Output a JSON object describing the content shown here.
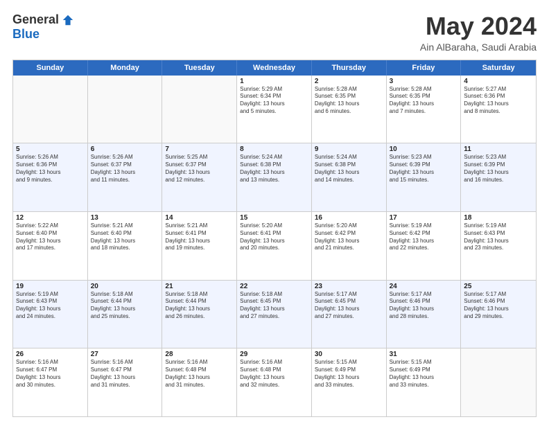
{
  "logo": {
    "general": "General",
    "blue": "Blue"
  },
  "title": "May 2024",
  "location": "Ain AlBaraha, Saudi Arabia",
  "days": [
    "Sunday",
    "Monday",
    "Tuesday",
    "Wednesday",
    "Thursday",
    "Friday",
    "Saturday"
  ],
  "weeks": [
    [
      {
        "day": "",
        "info": ""
      },
      {
        "day": "",
        "info": ""
      },
      {
        "day": "",
        "info": ""
      },
      {
        "day": "1",
        "info": "Sunrise: 5:29 AM\nSunset: 6:34 PM\nDaylight: 13 hours\nand 5 minutes."
      },
      {
        "day": "2",
        "info": "Sunrise: 5:28 AM\nSunset: 6:35 PM\nDaylight: 13 hours\nand 6 minutes."
      },
      {
        "day": "3",
        "info": "Sunrise: 5:28 AM\nSunset: 6:35 PM\nDaylight: 13 hours\nand 7 minutes."
      },
      {
        "day": "4",
        "info": "Sunrise: 5:27 AM\nSunset: 6:36 PM\nDaylight: 13 hours\nand 8 minutes."
      }
    ],
    [
      {
        "day": "5",
        "info": "Sunrise: 5:26 AM\nSunset: 6:36 PM\nDaylight: 13 hours\nand 9 minutes."
      },
      {
        "day": "6",
        "info": "Sunrise: 5:26 AM\nSunset: 6:37 PM\nDaylight: 13 hours\nand 11 minutes."
      },
      {
        "day": "7",
        "info": "Sunrise: 5:25 AM\nSunset: 6:37 PM\nDaylight: 13 hours\nand 12 minutes."
      },
      {
        "day": "8",
        "info": "Sunrise: 5:24 AM\nSunset: 6:38 PM\nDaylight: 13 hours\nand 13 minutes."
      },
      {
        "day": "9",
        "info": "Sunrise: 5:24 AM\nSunset: 6:38 PM\nDaylight: 13 hours\nand 14 minutes."
      },
      {
        "day": "10",
        "info": "Sunrise: 5:23 AM\nSunset: 6:39 PM\nDaylight: 13 hours\nand 15 minutes."
      },
      {
        "day": "11",
        "info": "Sunrise: 5:23 AM\nSunset: 6:39 PM\nDaylight: 13 hours\nand 16 minutes."
      }
    ],
    [
      {
        "day": "12",
        "info": "Sunrise: 5:22 AM\nSunset: 6:40 PM\nDaylight: 13 hours\nand 17 minutes."
      },
      {
        "day": "13",
        "info": "Sunrise: 5:21 AM\nSunset: 6:40 PM\nDaylight: 13 hours\nand 18 minutes."
      },
      {
        "day": "14",
        "info": "Sunrise: 5:21 AM\nSunset: 6:41 PM\nDaylight: 13 hours\nand 19 minutes."
      },
      {
        "day": "15",
        "info": "Sunrise: 5:20 AM\nSunset: 6:41 PM\nDaylight: 13 hours\nand 20 minutes."
      },
      {
        "day": "16",
        "info": "Sunrise: 5:20 AM\nSunset: 6:42 PM\nDaylight: 13 hours\nand 21 minutes."
      },
      {
        "day": "17",
        "info": "Sunrise: 5:19 AM\nSunset: 6:42 PM\nDaylight: 13 hours\nand 22 minutes."
      },
      {
        "day": "18",
        "info": "Sunrise: 5:19 AM\nSunset: 6:43 PM\nDaylight: 13 hours\nand 23 minutes."
      }
    ],
    [
      {
        "day": "19",
        "info": "Sunrise: 5:19 AM\nSunset: 6:43 PM\nDaylight: 13 hours\nand 24 minutes."
      },
      {
        "day": "20",
        "info": "Sunrise: 5:18 AM\nSunset: 6:44 PM\nDaylight: 13 hours\nand 25 minutes."
      },
      {
        "day": "21",
        "info": "Sunrise: 5:18 AM\nSunset: 6:44 PM\nDaylight: 13 hours\nand 26 minutes."
      },
      {
        "day": "22",
        "info": "Sunrise: 5:18 AM\nSunset: 6:45 PM\nDaylight: 13 hours\nand 27 minutes."
      },
      {
        "day": "23",
        "info": "Sunrise: 5:17 AM\nSunset: 6:45 PM\nDaylight: 13 hours\nand 27 minutes."
      },
      {
        "day": "24",
        "info": "Sunrise: 5:17 AM\nSunset: 6:46 PM\nDaylight: 13 hours\nand 28 minutes."
      },
      {
        "day": "25",
        "info": "Sunrise: 5:17 AM\nSunset: 6:46 PM\nDaylight: 13 hours\nand 29 minutes."
      }
    ],
    [
      {
        "day": "26",
        "info": "Sunrise: 5:16 AM\nSunset: 6:47 PM\nDaylight: 13 hours\nand 30 minutes."
      },
      {
        "day": "27",
        "info": "Sunrise: 5:16 AM\nSunset: 6:47 PM\nDaylight: 13 hours\nand 31 minutes."
      },
      {
        "day": "28",
        "info": "Sunrise: 5:16 AM\nSunset: 6:48 PM\nDaylight: 13 hours\nand 31 minutes."
      },
      {
        "day": "29",
        "info": "Sunrise: 5:16 AM\nSunset: 6:48 PM\nDaylight: 13 hours\nand 32 minutes."
      },
      {
        "day": "30",
        "info": "Sunrise: 5:15 AM\nSunset: 6:49 PM\nDaylight: 13 hours\nand 33 minutes."
      },
      {
        "day": "31",
        "info": "Sunrise: 5:15 AM\nSunset: 6:49 PM\nDaylight: 13 hours\nand 33 minutes."
      },
      {
        "day": "",
        "info": ""
      }
    ]
  ],
  "row_alt": [
    false,
    true,
    false,
    true,
    false
  ]
}
